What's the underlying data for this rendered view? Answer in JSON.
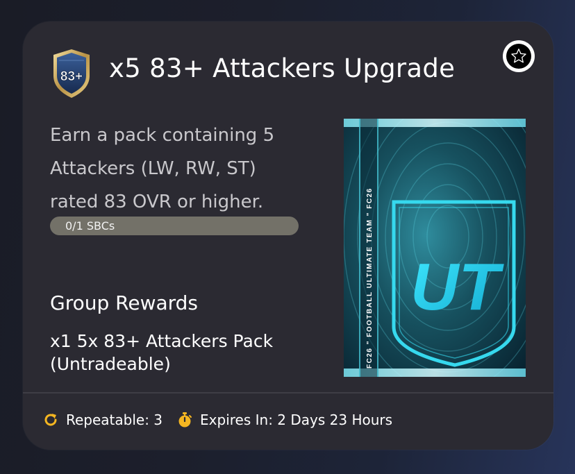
{
  "sbc": {
    "badge_text": "83+",
    "title": "x5 83+ Attackers Upgrade",
    "description": "Earn a pack containing 5 Attackers (LW, RW, ST) rated 83 OVR or higher.",
    "progress": {
      "text": "0/1 SBCs",
      "completed": 0,
      "total": 1
    },
    "favorite_icon": "star-icon"
  },
  "rewards": {
    "heading": "Group Rewards",
    "item": "x1 5x 83+ Attackers Pack (Untradeable)"
  },
  "pack": {
    "logo_text": "UT",
    "side_text": "FC26 \" FOOTBALL ULTIMATE TEAM \" FC26"
  },
  "footer": {
    "repeatable": "Repeatable: 3",
    "expires": "Expires In: 2 Days 23 Hours",
    "repeat_icon": "repeat-icon",
    "timer_icon": "stopwatch-icon"
  },
  "colors": {
    "card_bg": "#2b2a32",
    "accent_yellow": "#f5b621",
    "pack_cyan": "#2fd6ec",
    "progress_track": "#737168"
  }
}
